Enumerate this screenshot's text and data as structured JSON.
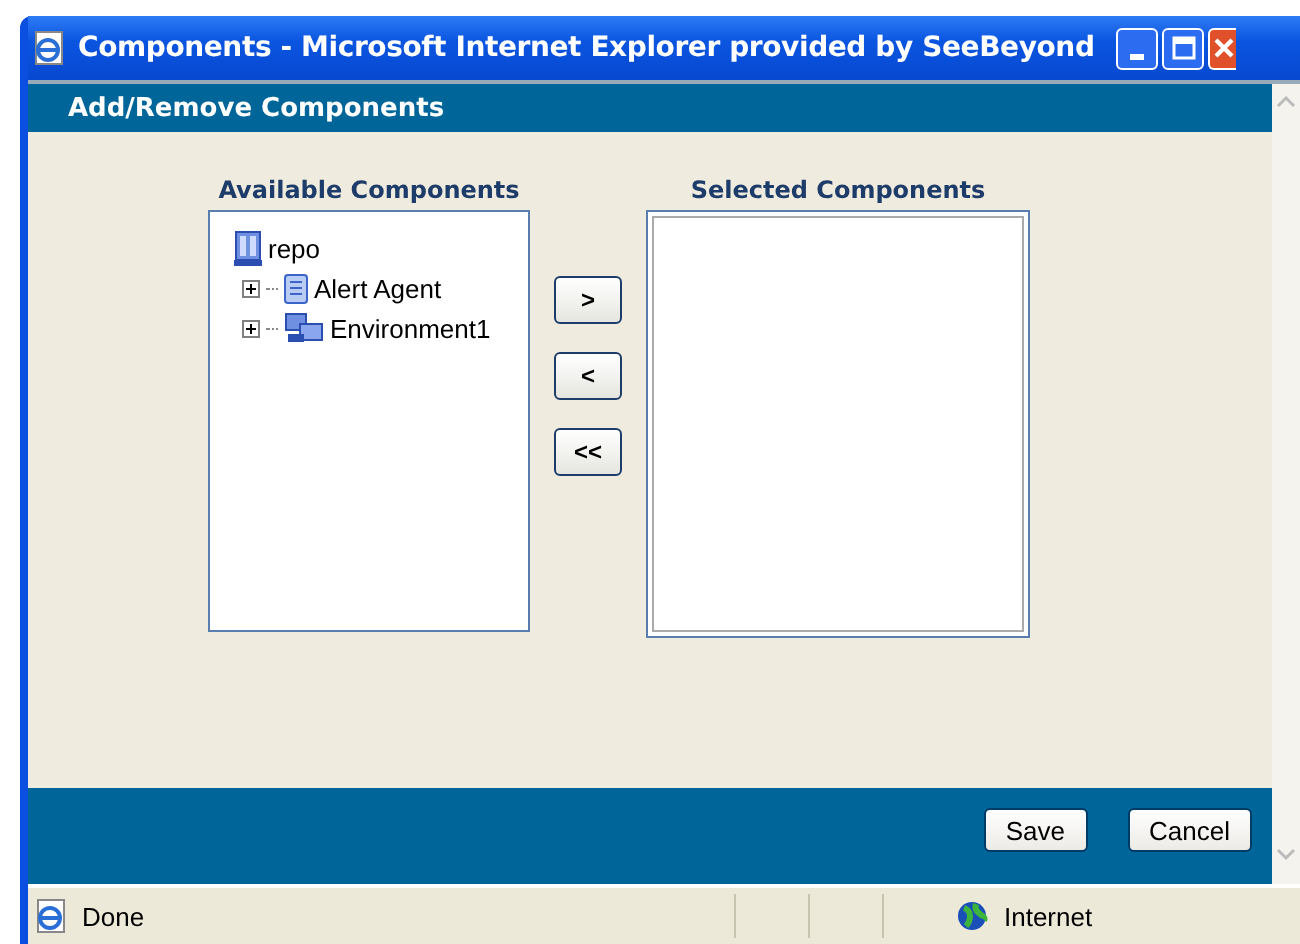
{
  "window": {
    "title": "Components - Microsoft Internet Explorer provided by SeeBeyond"
  },
  "header": {
    "title": "Add/Remove Components"
  },
  "available": {
    "title": "Available Components",
    "tree": [
      {
        "label": "repo",
        "kind": "repository",
        "children": [
          {
            "label": "Alert Agent",
            "kind": "agent",
            "expanded": false
          },
          {
            "label": "Environment1",
            "kind": "environment",
            "expanded": false
          }
        ]
      }
    ]
  },
  "move_buttons": [
    ">",
    "<",
    "<<"
  ],
  "selected": {
    "title": "Selected Components"
  },
  "buttons": [
    "Save",
    "Cancel"
  ],
  "status_bar": {
    "status": "Done",
    "zone": "Internet"
  }
}
